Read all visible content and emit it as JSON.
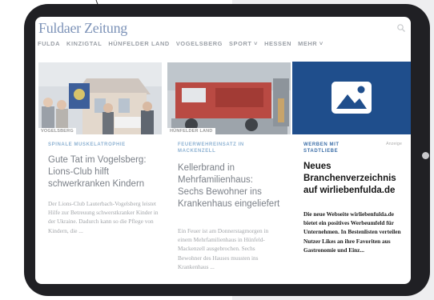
{
  "colors": {
    "tablet_frame": "#202024",
    "brand_blue": "#1f4e8c",
    "kicker_blue": "#8fb3d3",
    "ad_kicker": "#3d6fa8"
  },
  "header": {
    "logo": "Fuldaer Zeitung",
    "search_icon": "search-icon"
  },
  "nav": {
    "items": [
      "FULDA",
      "KINZIGTAL",
      "HÜNFELDER LAND",
      "VOGELSBERG",
      "SPORT ˅",
      "HESSEN",
      "MEHR ˅"
    ]
  },
  "articles": [
    {
      "tag": "VOGELSBERG",
      "kicker": "SPINALE MUSKELATROPHIE",
      "headline": "Gute Tat im Vogelsberg: Lions-Club hilft schwerkranken Kindern",
      "body": "Der Lions-Club Lauterbach-Vogelsberg leistet Hilfe zur Betreuung schwerstkranker Kinder in der Ukraine. Dadurch kann so die Pflege von Kindern, die ..."
    },
    {
      "tag": "HÜNFELDER LAND",
      "kicker": "FEUERWEHREINSATZ IN MACKENZELL",
      "headline": "Kellerbrand in Mehrfamilienhaus: Sechs Bewohner ins Krankenhaus eingeliefert",
      "body": "Ein Feuer ist am Donnerstagmorgen in einem Mehrfamilienhaus in Hünfeld-Mackenzell ausgebrochen. Sechs Bewohner des Hauses mussten ins Krankenhaus ..."
    },
    {
      "kicker": "WERBEN MIT STADTLIEBE",
      "label": "Anzeige",
      "headline": "Neues Branchenverzeichnis auf wirliebenfulda.de",
      "body": "Die neue Webseite wirliebenfulda.de bietet ein positives Werbeumfeld für Unternehmen. In Bestenlisten verteilen Nutzer Likes an ihre Favoriten aus Gastronomie und Einz..."
    }
  ]
}
